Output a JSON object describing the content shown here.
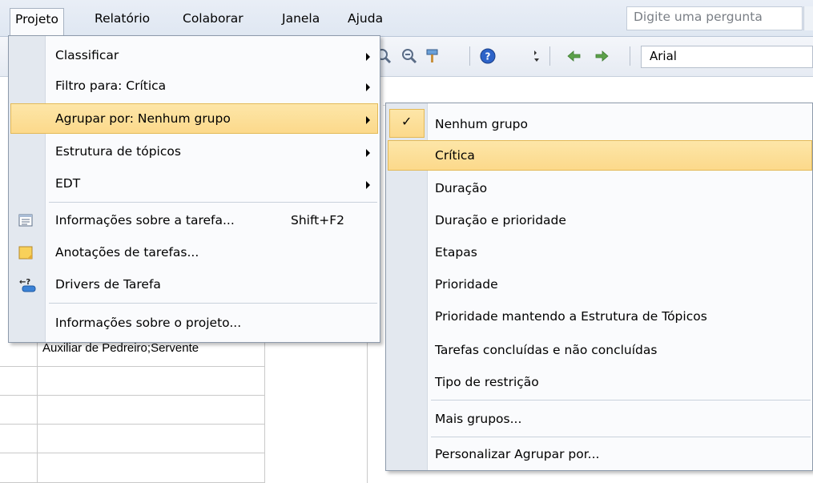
{
  "menubar": {
    "items": [
      {
        "label": "Projeto"
      },
      {
        "label": "Relatório"
      },
      {
        "label": "Colaborar"
      },
      {
        "label": "Janela"
      },
      {
        "label": "Ajuda"
      }
    ],
    "ask_placeholder": "Digite uma pergunta"
  },
  "toolbar": {
    "font": "Arial"
  },
  "project_menu": {
    "items": [
      {
        "label": "Classificar",
        "submenu": true
      },
      {
        "label": "Filtro para: Crítica",
        "submenu": true
      },
      {
        "label": "Agrupar por: Nenhum grupo",
        "submenu": true,
        "highlighted": true
      },
      {
        "label": "Estrutura de tópicos",
        "submenu": true
      },
      {
        "label": "EDT",
        "submenu": true
      },
      {
        "label": "Informações sobre a tarefa...",
        "shortcut": "Shift+F2",
        "icon": "task-info-icon"
      },
      {
        "label": "Anotações de tarefas...",
        "icon": "task-notes-icon"
      },
      {
        "label": "Drivers de Tarefa",
        "icon": "task-drivers-icon"
      },
      {
        "label": "Informações sobre o projeto..."
      }
    ]
  },
  "group_submenu": {
    "items": [
      {
        "label": "Nenhum grupo",
        "checked": true
      },
      {
        "label": "Crítica",
        "highlighted": true
      },
      {
        "label": "Duração"
      },
      {
        "label": "Duração e prioridade"
      },
      {
        "label": "Etapas"
      },
      {
        "label": "Prioridade"
      },
      {
        "label": "Prioridade mantendo a Estrutura de Tópicos"
      },
      {
        "label": "Tarefas concluídas e não concluídas"
      },
      {
        "label": "Tipo de restrição"
      },
      {
        "label": "Mais grupos..."
      },
      {
        "label": "Personalizar Agrupar por..."
      }
    ]
  },
  "grid": {
    "cell_text": "Auxiliar de Pedreiro;Servente"
  }
}
